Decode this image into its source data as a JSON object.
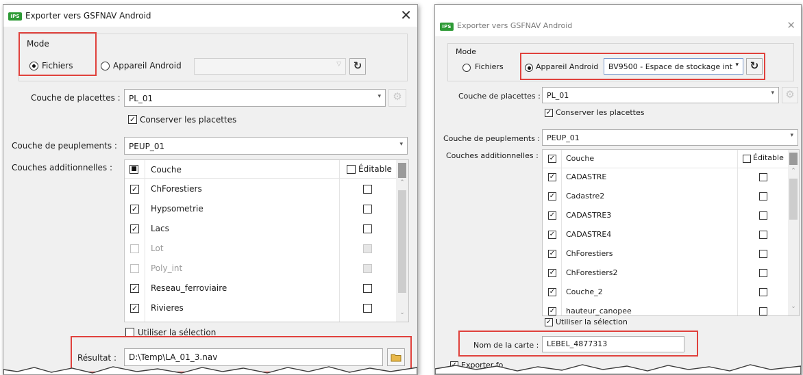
{
  "dialog1": {
    "title": "Exporter vers GSFNAV Android",
    "close": "✕",
    "mode_label": "Mode",
    "radio_files": "Fichiers",
    "radio_android": "Appareil Android",
    "device_value": "",
    "placettes_label": "Couche de placettes :",
    "placettes_value": "PL_01",
    "keep_placettes": "Conserver les placettes",
    "peuplements_label": "Couche de peuplements :",
    "peuplements_value": "PEUP_01",
    "additional_label": "Couches additionnelles :",
    "col_layer": "Couche",
    "col_editable": "Éditable",
    "rows": [
      {
        "name": "ChForestiers"
      },
      {
        "name": "Hypsometrie"
      },
      {
        "name": "Lacs"
      },
      {
        "name": "Lot"
      },
      {
        "name": "Poly_int"
      },
      {
        "name": "Reseau_ferroviaire"
      },
      {
        "name": "Rivieres"
      }
    ],
    "use_selection": "Utiliser la sélection",
    "result_label": "Résultat :",
    "result_value": "D:\\Temp\\LA_01_3.nav"
  },
  "dialog2": {
    "title": "Exporter vers GSFNAV Android",
    "close": "✕",
    "mode_label": "Mode",
    "radio_files": "Fichiers",
    "radio_android": "Appareil Android",
    "device_value": "BV9500 - Espace de stockage int",
    "placettes_label": "Couche de placettes :",
    "placettes_value": "PL_01",
    "keep_placettes": "Conserver les placettes",
    "peuplements_label": "Couche de peuplements :",
    "peuplements_value": "PEUP_01",
    "additional_label": "Couches additionnelles :",
    "col_layer": "Couche",
    "col_editable": "Éditable",
    "rows": [
      {
        "name": "CADASTRE"
      },
      {
        "name": "Cadastre2"
      },
      {
        "name": "CADASTRE3"
      },
      {
        "name": "CADASTRE4"
      },
      {
        "name": "ChForestiers"
      },
      {
        "name": "ChForestiers2"
      },
      {
        "name": "Couche_2"
      },
      {
        "name": "hauteur_canopee"
      }
    ],
    "use_selection": "Utiliser la sélection",
    "map_name_label": "Nom de la carte :",
    "map_name_value": "LEBEL_4877313",
    "partial_option": "Exporter fo"
  },
  "icons": {
    "app": "IPS",
    "refresh": "refresh-icon",
    "folder": "folder-icon",
    "layer_settings": "layer-settings-icon"
  },
  "colors": {
    "highlight": "#e0413c",
    "dialog_bg": "#f0f0f0",
    "app_icon": "#2d9a35",
    "folder": "#e8b84a"
  }
}
